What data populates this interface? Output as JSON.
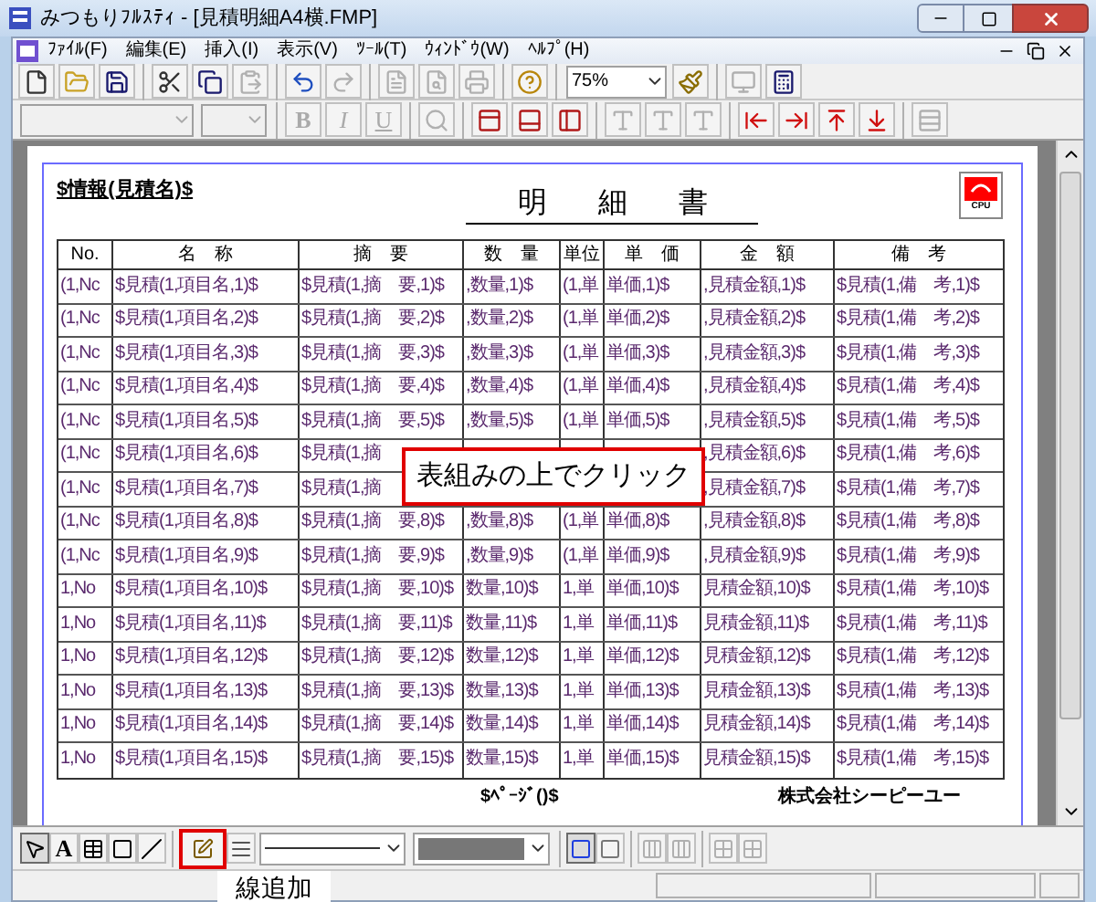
{
  "window": {
    "title": "みつもりﾌﾙｽﾃｨ - [見積明細A4横.FMP]"
  },
  "menu": [
    "ﾌｧｲﾙ(F)",
    "編集(E)",
    "挿入(I)",
    "表示(V)",
    "ﾂｰﾙ(T)",
    "ｳｨﾝﾄﾞｳ(W)",
    "ﾍﾙﾌﾟ(H)"
  ],
  "toolbar": [
    {
      "kind": "button",
      "disabled": false
    },
    {
      "kind": "button",
      "disabled": false
    },
    {
      "kind": "button",
      "disabled": false
    },
    {
      "kind": "separator"
    },
    {
      "kind": "button",
      "disabled": false
    },
    {
      "kind": "button",
      "disabled": false
    },
    {
      "kind": "button",
      "disabled": true
    },
    {
      "kind": "separator"
    },
    {
      "kind": "button",
      "disabled": false
    },
    {
      "kind": "button",
      "disabled": true
    },
    {
      "kind": "separator"
    },
    {
      "kind": "button",
      "disabled": true
    },
    {
      "kind": "button",
      "disabled": true
    },
    {
      "kind": "button",
      "disabled": true
    },
    {
      "kind": "separator"
    },
    {
      "kind": "button",
      "disabled": false
    },
    {
      "kind": "separator"
    },
    {
      "kind": "dropdown",
      "value": "75%",
      "disabled": false
    },
    {
      "kind": "button",
      "disabled": false
    },
    {
      "kind": "separator"
    },
    {
      "kind": "button",
      "disabled": true
    },
    {
      "kind": "button",
      "disabled": false
    }
  ],
  "format_toolbar": [
    {
      "kind": "dropdown",
      "disabled": true
    },
    {
      "kind": "dropdown",
      "disabled": true
    },
    {
      "kind": "separator"
    },
    {
      "kind": "text",
      "label": "B",
      "disabled": true
    },
    {
      "kind": "text",
      "label": "I",
      "disabled": true
    },
    {
      "kind": "text",
      "label": "U",
      "disabled": true
    },
    {
      "kind": "separator"
    },
    {
      "kind": "button",
      "disabled": true
    },
    {
      "kind": "separator"
    },
    {
      "kind": "button",
      "disabled": false
    },
    {
      "kind": "button",
      "disabled": false
    },
    {
      "kind": "button",
      "disabled": false
    },
    {
      "kind": "separator"
    },
    {
      "kind": "button",
      "disabled": true
    },
    {
      "kind": "button",
      "disabled": true
    },
    {
      "kind": "button",
      "disabled": true
    },
    {
      "kind": "separator"
    },
    {
      "kind": "button",
      "disabled": false
    },
    {
      "kind": "button",
      "disabled": false
    },
    {
      "kind": "button",
      "disabled": false
    },
    {
      "kind": "button",
      "disabled": false
    },
    {
      "kind": "separator"
    },
    {
      "kind": "button",
      "disabled": true
    }
  ],
  "page": {
    "info_field": "$情報(見積名)$",
    "title": "明細書",
    "logo_text": "CPU",
    "page_field": "$ﾍﾟｰｼﾞ()$",
    "company": "株式会社シーピーユー"
  },
  "table": {
    "columns": [
      "No.",
      "名　称",
      "摘　要",
      "数　量",
      "単位",
      "単　価",
      "金　額",
      "備　考"
    ],
    "rows": [
      {
        "no": "(1,Nc",
        "name": "$見積(1,項目名,1)$",
        "summary": "$見積(1,摘　要,1)$",
        "qty": ",数量,1)$",
        "unit": "(1,単",
        "price": "単価,1)$",
        "amount": ",見積金額,1)$",
        "remarks": "$見積(1,備　考,1)$"
      },
      {
        "no": "(1,Nc",
        "name": "$見積(1,項目名,2)$",
        "summary": "$見積(1,摘　要,2)$",
        "qty": ",数量,2)$",
        "unit": "(1,単",
        "price": "単価,2)$",
        "amount": ",見積金額,2)$",
        "remarks": "$見積(1,備　考,2)$"
      },
      {
        "no": "(1,Nc",
        "name": "$見積(1,項目名,3)$",
        "summary": "$見積(1,摘　要,3)$",
        "qty": ",数量,3)$",
        "unit": "(1,単",
        "price": "単価,3)$",
        "amount": ",見積金額,3)$",
        "remarks": "$見積(1,備　考,3)$"
      },
      {
        "no": "(1,Nc",
        "name": "$見積(1,項目名,4)$",
        "summary": "$見積(1,摘　要,4)$",
        "qty": ",数量,4)$",
        "unit": "(1,単",
        "price": "単価,4)$",
        "amount": ",見積金額,4)$",
        "remarks": "$見積(1,備　考,4)$"
      },
      {
        "no": "(1,Nc",
        "name": "$見積(1,項目名,5)$",
        "summary": "$見積(1,摘　要,5)$",
        "qty": ",数量,5)$",
        "unit": "(1,単",
        "price": "単価,5)$",
        "amount": ",見積金額,5)$",
        "remarks": "$見積(1,備　考,5)$"
      },
      {
        "no": "(1,Nc",
        "name": "$見積(1,項目名,6)$",
        "summary": "$見積(1,摘",
        "amount": ",見積金額,6)$",
        "remarks": "$見積(1,備　考,6)$"
      },
      {
        "no": "(1,Nc",
        "name": "$見積(1,項目名,7)$",
        "summary": "$見積(1,摘",
        "amount": ",見積金額,7)$",
        "remarks": "$見積(1,備　考,7)$"
      },
      {
        "no": "(1,Nc",
        "name": "$見積(1,項目名,8)$",
        "summary": "$見積(1,摘　要,8)$",
        "qty": ",数量,8)$",
        "unit": "(1,単",
        "price": "単価,8)$",
        "amount": ",見積金額,8)$",
        "remarks": "$見積(1,備　考,8)$"
      },
      {
        "no": "(1,Nc",
        "name": "$見積(1,項目名,9)$",
        "summary": "$見積(1,摘　要,9)$",
        "qty": ",数量,9)$",
        "unit": "(1,単",
        "price": "単価,9)$",
        "amount": ",見積金額,9)$",
        "remarks": "$見積(1,備　考,9)$"
      },
      {
        "no": "1,No",
        "name": "$見積(1,項目名,10)$",
        "summary": "$見積(1,摘　要,10)$",
        "qty": "数量,10)$",
        "unit": "1,単",
        "price": "単価,10)$",
        "amount": "見積金額,10)$",
        "remarks": "$見積(1,備　考,10)$"
      },
      {
        "no": "1,No",
        "name": "$見積(1,項目名,11)$",
        "summary": "$見積(1,摘　要,11)$",
        "qty": "数量,11)$",
        "unit": "1,単",
        "price": "単価,11)$",
        "amount": "見積金額,11)$",
        "remarks": "$見積(1,備　考,11)$"
      },
      {
        "no": "1,No",
        "name": "$見積(1,項目名,12)$",
        "summary": "$見積(1,摘　要,12)$",
        "qty": "数量,12)$",
        "unit": "1,単",
        "price": "単価,12)$",
        "amount": "見積金額,12)$",
        "remarks": "$見積(1,備　考,12)$"
      },
      {
        "no": "1,No",
        "name": "$見積(1,項目名,13)$",
        "summary": "$見積(1,摘　要,13)$",
        "qty": "数量,13)$",
        "unit": "1,単",
        "price": "単価,13)$",
        "amount": "見積金額,13)$",
        "remarks": "$見積(1,備　考,13)$"
      },
      {
        "no": "1,No",
        "name": "$見積(1,項目名,14)$",
        "summary": "$見積(1,摘　要,14)$",
        "qty": "数量,14)$",
        "unit": "1,単",
        "price": "単価,14)$",
        "amount": "見積金額,14)$",
        "remarks": "$見積(1,備　考,14)$"
      },
      {
        "no": "1,No",
        "name": "$見積(1,項目名,15)$",
        "summary": "$見積(1,摘　要,15)$",
        "qty": "数量,15)$",
        "unit": "1,単",
        "price": "単価,15)$",
        "amount": "見積金額,15)$",
        "remarks": "$見積(1,備　考,15)$"
      }
    ]
  },
  "draw_toolbar": [
    {
      "kind": "button",
      "selected": true,
      "highlighted": false
    },
    {
      "kind": "text",
      "label": "A",
      "selected": false,
      "highlighted": false
    },
    {
      "kind": "button",
      "selected": false,
      "highlighted": false
    },
    {
      "kind": "button",
      "selected": false,
      "highlighted": false
    },
    {
      "kind": "button",
      "selected": false,
      "highlighted": false
    },
    {
      "kind": "separator"
    },
    {
      "kind": "button",
      "selected": false,
      "highlighted": true
    },
    {
      "kind": "button",
      "selected": false,
      "highlighted": false
    },
    {
      "kind": "dropdown"
    },
    {
      "kind": "dropdown"
    },
    {
      "kind": "separator"
    },
    {
      "kind": "button",
      "selected": true,
      "highlighted": false
    },
    {
      "kind": "button",
      "selected": false,
      "highlighted": false
    },
    {
      "kind": "separator"
    },
    {
      "kind": "button",
      "selected": false,
      "highlighted": false,
      "disabled": true
    },
    {
      "kind": "button",
      "selected": false,
      "highlighted": false,
      "disabled": true
    },
    {
      "kind": "separator"
    },
    {
      "kind": "button",
      "selected": false,
      "highlighted": false,
      "disabled": true
    },
    {
      "kind": "button",
      "selected": false,
      "highlighted": false,
      "disabled": true
    }
  ],
  "callouts": [
    {
      "text": "表組みの上でクリック",
      "bordered": true
    },
    {
      "text": "線追加",
      "bordered": false
    }
  ]
}
